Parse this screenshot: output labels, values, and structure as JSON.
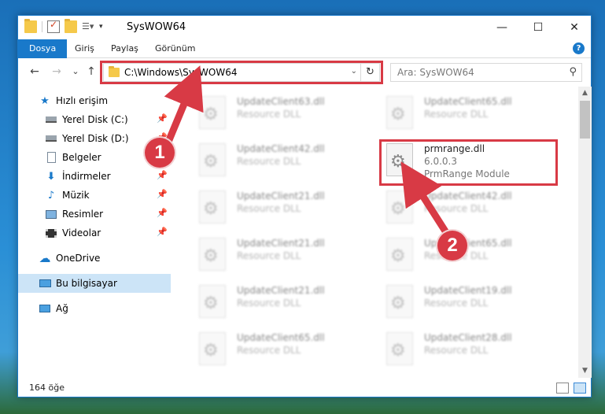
{
  "window": {
    "title": "SysWOW64",
    "controls": {
      "minimize": "—",
      "maximize": "☐",
      "close": "✕"
    }
  },
  "ribbon": {
    "tabs": [
      "Dosya",
      "Giriş",
      "Paylaş",
      "Görünüm"
    ],
    "help": "?"
  },
  "navigation": {
    "back": "←",
    "forward": "→",
    "recent": "⌄",
    "up": "↑",
    "address_path": "C:\\Windows\\SysWOW64",
    "refresh": "↻",
    "search_placeholder": "Ara: SysWOW64"
  },
  "sidebar": {
    "items": [
      {
        "label": "Hızlı erişim",
        "icon": "star-icon",
        "pinned": false
      },
      {
        "label": "Yerel Disk (C:)",
        "icon": "drive-icon",
        "pinned": true
      },
      {
        "label": "Yerel Disk (D:)",
        "icon": "drive-icon",
        "pinned": true
      },
      {
        "label": "Belgeler",
        "icon": "documents-icon",
        "pinned": true
      },
      {
        "label": "İndirmeler",
        "icon": "download-icon",
        "pinned": true
      },
      {
        "label": "Müzik",
        "icon": "music-icon",
        "pinned": true
      },
      {
        "label": "Resimler",
        "icon": "pictures-icon",
        "pinned": true
      },
      {
        "label": "Videolar",
        "icon": "video-icon",
        "pinned": true
      },
      {
        "label": "OneDrive",
        "icon": "cloud-icon",
        "pinned": false
      },
      {
        "label": "Bu bilgisayar",
        "icon": "computer-icon",
        "pinned": false,
        "selected": true
      },
      {
        "label": "Ağ",
        "icon": "network-icon",
        "pinned": false
      }
    ]
  },
  "files": {
    "left_column": [
      {
        "name": "UpdateClient63.dll",
        "desc": "Resource DLL"
      },
      {
        "name": "UpdateClient42.dll",
        "desc": "Resource DLL"
      },
      {
        "name": "UpdateClient21.dll",
        "desc": "Resource DLL"
      },
      {
        "name": "UpdateClient21.dll",
        "desc": "Resource DLL"
      },
      {
        "name": "UpdateClient21.dll",
        "desc": "Resource DLL"
      },
      {
        "name": "UpdateClient65.dll",
        "desc": "Resource DLL"
      }
    ],
    "right_column": [
      {
        "name": "UpdateClient65.dll",
        "desc": "Resource DLL"
      },
      {
        "name": "prmrange.dll",
        "desc": "6.0.0.3",
        "desc2": "PrmRange Module",
        "highlighted": true
      },
      {
        "name": "UpdateClient42.dll",
        "desc": "Resource DLL"
      },
      {
        "name": "UpdateClient65.dll",
        "desc": "Resource DLL"
      },
      {
        "name": "UpdateClient19.dll",
        "desc": "Resource DLL"
      },
      {
        "name": "UpdateClient28.dll",
        "desc": "Resource DLL"
      }
    ]
  },
  "status": {
    "item_count": "164 öğe"
  },
  "annotations": {
    "marker1": "1",
    "marker2": "2",
    "color": "#d83a45"
  }
}
